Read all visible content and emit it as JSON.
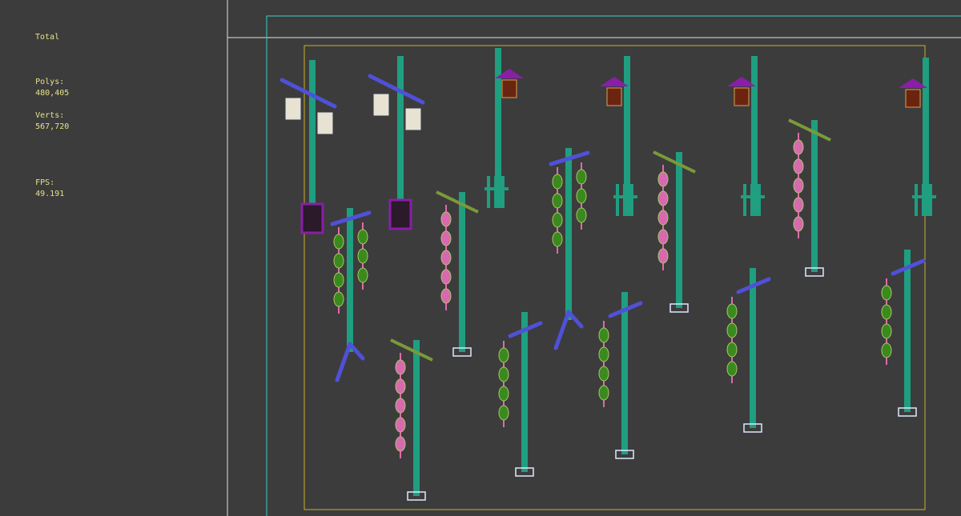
{
  "stats": {
    "total_label": "Total",
    "polys_label": "Polys:",
    "polys_value": "480,405",
    "verts_label": "Verts:",
    "verts_value": "567,720",
    "fps_label": "FPS:",
    "fps_value": "49.191"
  },
  "colors": {
    "background": "#3c3c3c",
    "pole": "#1f9e80",
    "crossbar": "#5050d8",
    "lantern_green": "#3a8a1e",
    "lantern_pink": "#d869b0",
    "lantern_purple": "#8a1ea8",
    "safe_frame_outer": "#3ad0c8",
    "safe_frame_inner": "#c8b02a",
    "divider": "#e0e0e0"
  },
  "scene": {
    "object_type": "lantern-poles",
    "icons": [
      "lantern-pole-icon",
      "hanging-lantern-icon",
      "pole-base-icon"
    ]
  }
}
